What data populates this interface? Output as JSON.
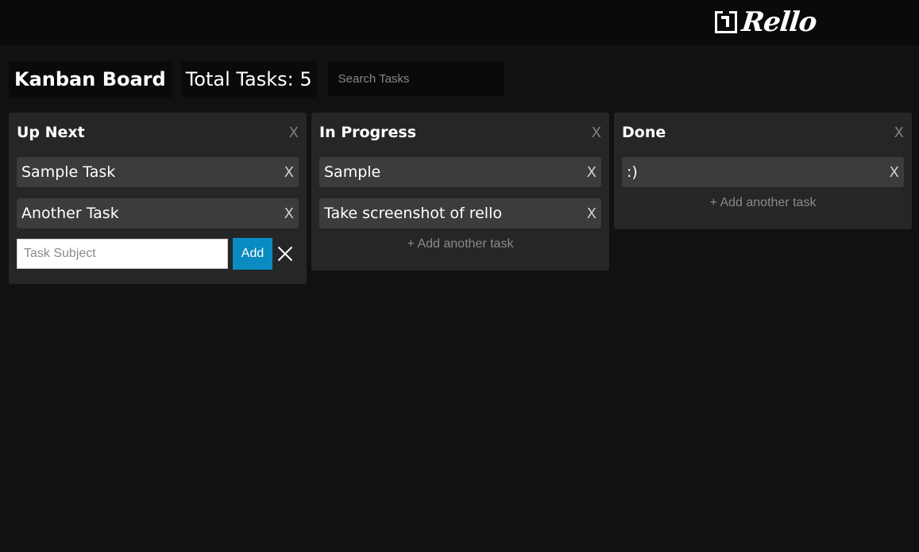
{
  "app": {
    "logo_text": "Rello"
  },
  "header": {
    "board_title": "Kanban Board",
    "total_tasks_label": "Total Tasks: 5",
    "search_placeholder": "Search Tasks",
    "search_value": ""
  },
  "columns": [
    {
      "title": "Up Next",
      "close_label": "X",
      "tasks": [
        {
          "text": "Sample Task",
          "close_label": "X"
        },
        {
          "text": "Another Task",
          "close_label": "X"
        }
      ],
      "add_form": {
        "input_placeholder": "Task Subject",
        "input_value": "",
        "add_button_label": "Add"
      }
    },
    {
      "title": "In Progress",
      "close_label": "X",
      "tasks": [
        {
          "text": "Sample",
          "close_label": "X"
        },
        {
          "text": "Take screenshot of rello",
          "close_label": "X"
        }
      ],
      "add_link_label": "+ Add another task"
    },
    {
      "title": "Done",
      "close_label": "X",
      "tasks": [
        {
          "text": ":)",
          "close_label": "X"
        }
      ],
      "add_link_label": "+ Add another task"
    }
  ],
  "colors": {
    "background": "#111111",
    "topbar": "#0a0a0a",
    "column": "#262626",
    "task": "#3c3c3c",
    "accent_button": "#0a8bc2"
  }
}
